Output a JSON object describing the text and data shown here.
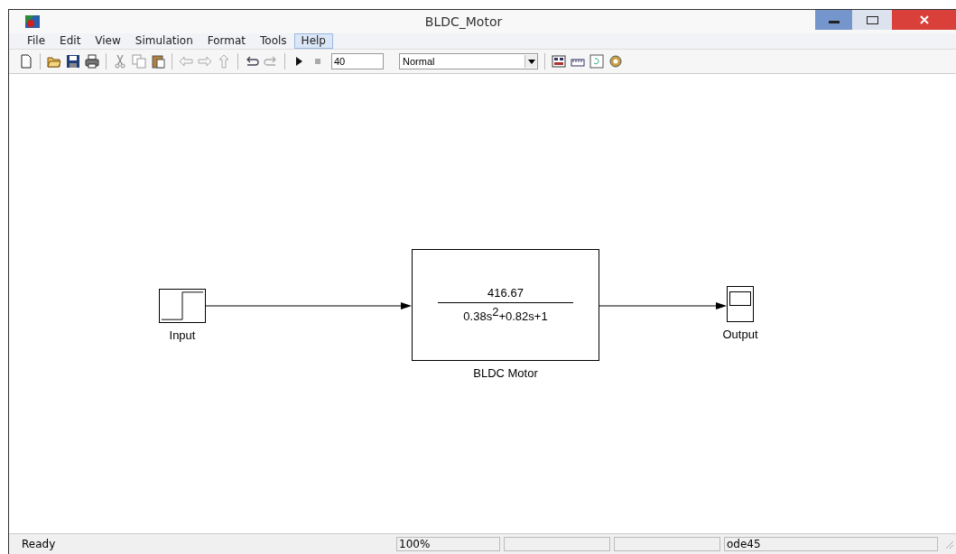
{
  "window": {
    "title": "BLDC_Motor"
  },
  "menu": [
    {
      "label": "File",
      "selected": false
    },
    {
      "label": "Edit",
      "selected": false
    },
    {
      "label": "View",
      "selected": false
    },
    {
      "label": "Simulation",
      "selected": false
    },
    {
      "label": "Format",
      "selected": false
    },
    {
      "label": "Tools",
      "selected": false
    },
    {
      "label": "Help",
      "selected": true
    }
  ],
  "toolbar": {
    "stop_time": "40",
    "mode": "Normal"
  },
  "diagram": {
    "blocks": [
      {
        "kind": "step",
        "label": "Input"
      },
      {
        "kind": "transfer_fcn",
        "label": "BLDC Motor",
        "numerator": "416.67",
        "denominator": "0.38s$^{2}$+0.82s+1"
      },
      {
        "kind": "scope",
        "label": "Output"
      }
    ]
  },
  "status_bar": {
    "message": "Ready",
    "zoom": "100%",
    "solver": "ode45"
  }
}
